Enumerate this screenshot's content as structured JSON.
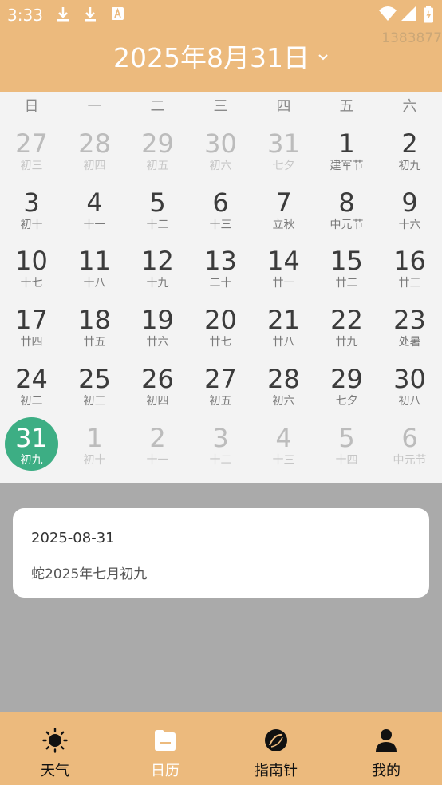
{
  "status": {
    "time": "3:33",
    "watermark": "1383877"
  },
  "header": {
    "title": "2025年8月31日"
  },
  "weekdays": [
    "日",
    "一",
    "二",
    "三",
    "四",
    "五",
    "六"
  ],
  "days": [
    {
      "d": "27",
      "l": "初三",
      "other": true
    },
    {
      "d": "28",
      "l": "初四",
      "other": true
    },
    {
      "d": "29",
      "l": "初五",
      "other": true
    },
    {
      "d": "30",
      "l": "初六",
      "other": true
    },
    {
      "d": "31",
      "l": "七夕",
      "other": true
    },
    {
      "d": "1",
      "l": "建军节"
    },
    {
      "d": "2",
      "l": "初九"
    },
    {
      "d": "3",
      "l": "初十"
    },
    {
      "d": "4",
      "l": "十一"
    },
    {
      "d": "5",
      "l": "十二"
    },
    {
      "d": "6",
      "l": "十三"
    },
    {
      "d": "7",
      "l": "立秋"
    },
    {
      "d": "8",
      "l": "中元节"
    },
    {
      "d": "9",
      "l": "十六"
    },
    {
      "d": "10",
      "l": "十七"
    },
    {
      "d": "11",
      "l": "十八"
    },
    {
      "d": "12",
      "l": "十九"
    },
    {
      "d": "13",
      "l": "二十"
    },
    {
      "d": "14",
      "l": "廿一"
    },
    {
      "d": "15",
      "l": "廿二"
    },
    {
      "d": "16",
      "l": "廿三"
    },
    {
      "d": "17",
      "l": "廿四"
    },
    {
      "d": "18",
      "l": "廿五"
    },
    {
      "d": "19",
      "l": "廿六"
    },
    {
      "d": "20",
      "l": "廿七"
    },
    {
      "d": "21",
      "l": "廿八"
    },
    {
      "d": "22",
      "l": "廿九"
    },
    {
      "d": "23",
      "l": "处暑"
    },
    {
      "d": "24",
      "l": "初二"
    },
    {
      "d": "25",
      "l": "初三"
    },
    {
      "d": "26",
      "l": "初四"
    },
    {
      "d": "27",
      "l": "初五"
    },
    {
      "d": "28",
      "l": "初六"
    },
    {
      "d": "29",
      "l": "七夕"
    },
    {
      "d": "30",
      "l": "初八"
    },
    {
      "d": "31",
      "l": "初九",
      "selected": true
    },
    {
      "d": "1",
      "l": "初十",
      "other": true
    },
    {
      "d": "2",
      "l": "十一",
      "other": true
    },
    {
      "d": "3",
      "l": "十二",
      "other": true
    },
    {
      "d": "4",
      "l": "十三",
      "other": true
    },
    {
      "d": "5",
      "l": "十四",
      "other": true
    },
    {
      "d": "6",
      "l": "中元节",
      "other": true
    }
  ],
  "info": {
    "date": "2025-08-31",
    "lunar": "蛇2025年七月初九"
  },
  "tabs": [
    {
      "label": "天气",
      "icon": "sun-icon"
    },
    {
      "label": "日历",
      "icon": "calendar-icon",
      "active": true
    },
    {
      "label": "指南针",
      "icon": "compass-icon"
    },
    {
      "label": "我的",
      "icon": "person-icon"
    }
  ],
  "colors": {
    "accent": "#ecba7d",
    "selected": "#3dae84",
    "background": "#aaaaaa"
  }
}
